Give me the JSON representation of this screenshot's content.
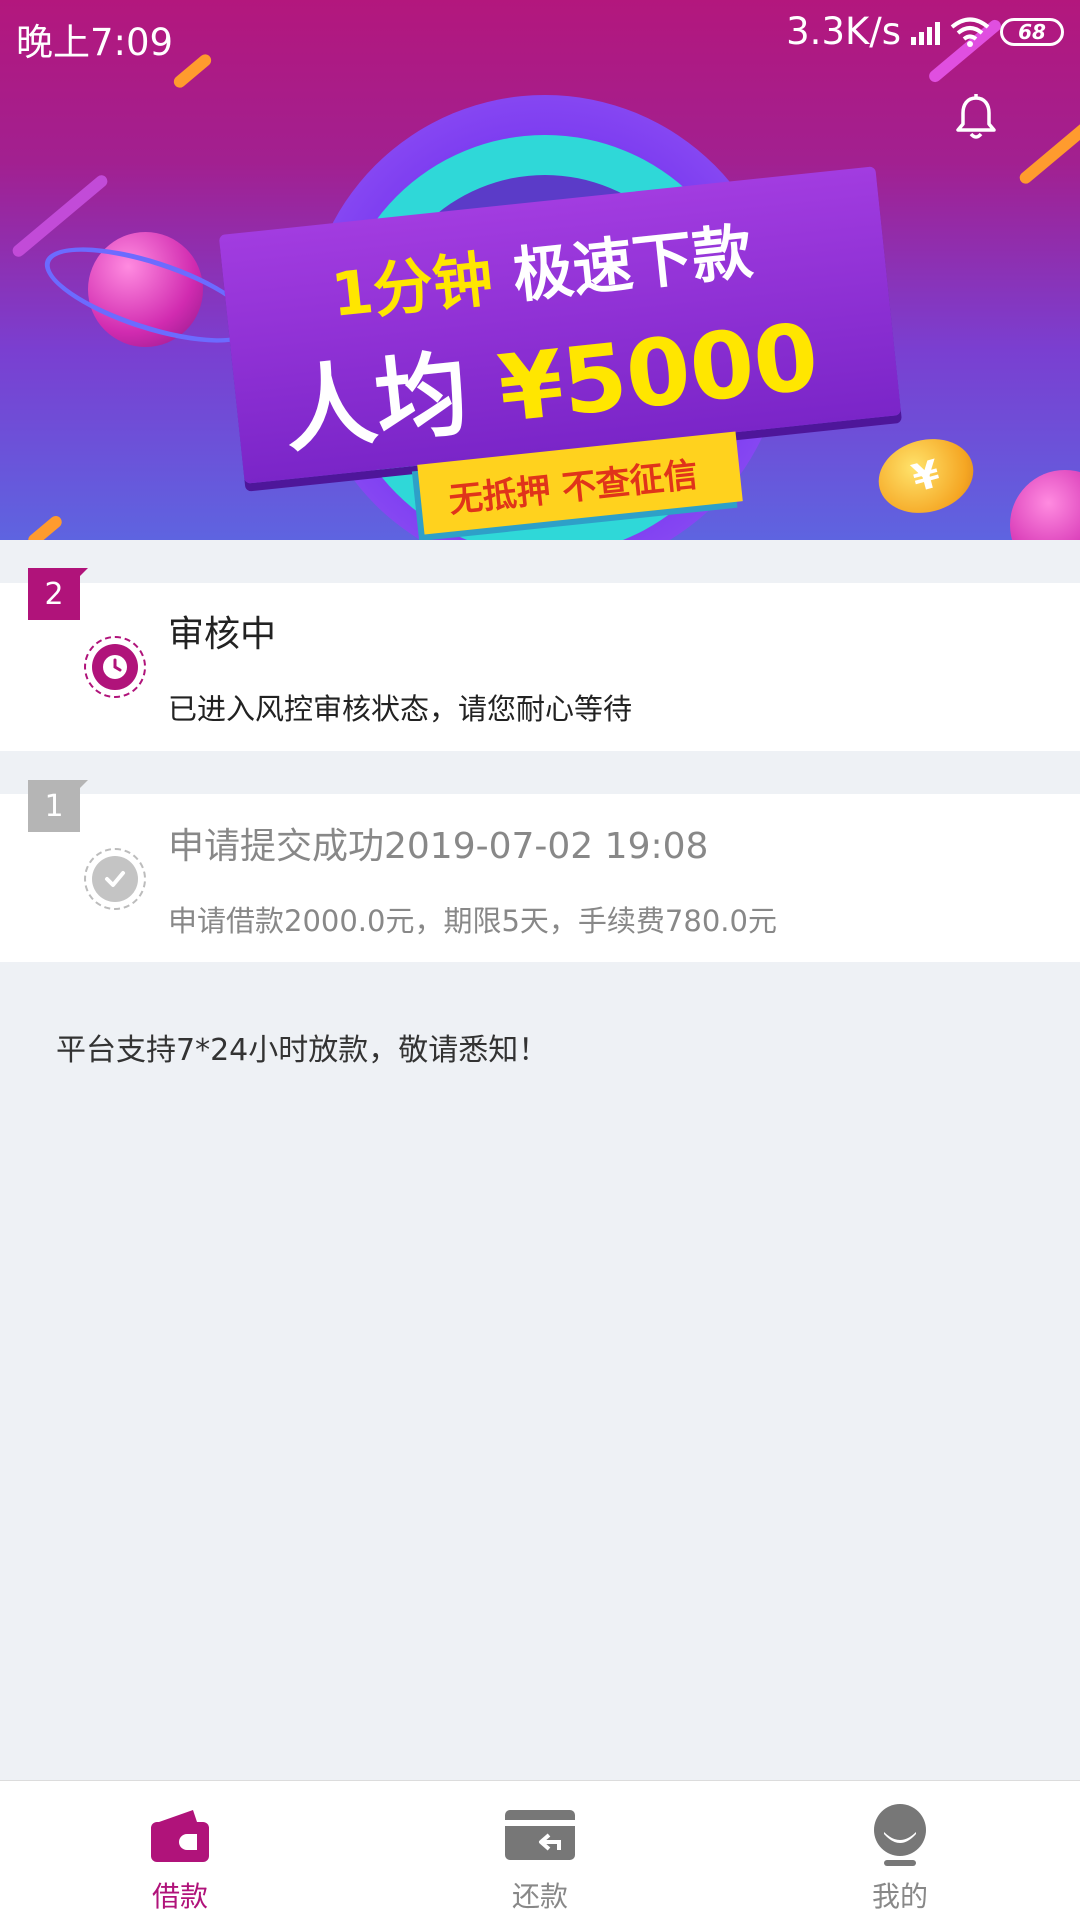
{
  "status_bar": {
    "time": "晚上7:09",
    "network_speed": "3.3K/s",
    "battery": "68"
  },
  "banner": {
    "line1_highlight": "1分钟",
    "line1_text": "极速下款",
    "line2_text": "人均",
    "line2_amount": "¥5000",
    "tag": "无抵押 不查征信"
  },
  "steps": [
    {
      "number": "2",
      "title": "审核中",
      "description": "已进入风控审核状态，请您耐心等待",
      "state": "active",
      "icon": "clock-icon"
    },
    {
      "number": "1",
      "title": "申请提交成功2019-07-02 19:08",
      "description": "申请借款2000.0元，期限5天，手续费780.0元",
      "state": "done",
      "icon": "check-icon"
    }
  ],
  "notice": "平台支持7*24小时放款，敬请悉知！",
  "tabs": [
    {
      "label": "借款",
      "icon": "wallet-icon",
      "active": true
    },
    {
      "label": "还款",
      "icon": "repay-card-icon",
      "active": false
    },
    {
      "label": "我的",
      "icon": "user-icon",
      "active": false
    }
  ],
  "colors": {
    "accent": "#b0137a",
    "inactive": "#b5b5b5",
    "background": "#eef1f5"
  }
}
